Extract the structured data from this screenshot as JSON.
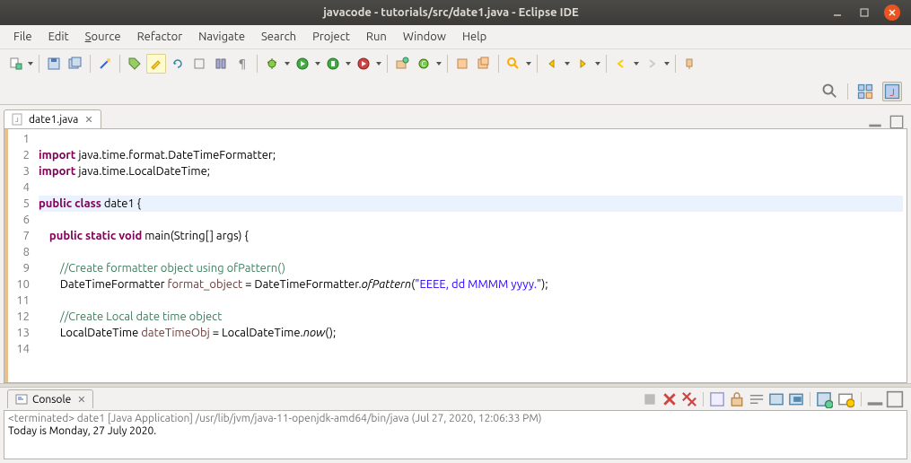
{
  "window": {
    "title": "javacode - tutorials/src/date1.java - Eclipse IDE"
  },
  "menu": {
    "items": [
      "File",
      "Edit",
      "Source",
      "Refactor",
      "Navigate",
      "Search",
      "Project",
      "Run",
      "Window",
      "Help"
    ]
  },
  "editor": {
    "tab_label": "date1.java",
    "lines": [
      {
        "n": "1",
        "text": ""
      },
      {
        "n": "2",
        "html": "<span class='kw'>import</span> java.time.format.DateTimeFormatter;"
      },
      {
        "n": "3",
        "html": "<span class='kw'>import</span> java.time.LocalDateTime;"
      },
      {
        "n": "4",
        "text": ""
      },
      {
        "n": "5",
        "html": "<span class='kw'>public</span> <span class='kw'>class</span> date1 {",
        "highlight": true
      },
      {
        "n": "6",
        "text": ""
      },
      {
        "n": "7",
        "html": "    <span class='kw'>public</span> <span class='kw'>static</span> <span class='kw'>void</span> main(String[] args) {"
      },
      {
        "n": "8",
        "text": ""
      },
      {
        "n": "9",
        "html": "        <span class='cm'>//Create formatter object using ofPattern()</span>"
      },
      {
        "n": "10",
        "html": "        DateTimeFormatter <span style='color:#6a3e3e'>format_object</span> = DateTimeFormatter.<span class='st'>ofPattern</span>(<span class='str'>\"EEEE, dd MMMM yyyy.\"</span>);"
      },
      {
        "n": "11",
        "text": ""
      },
      {
        "n": "12",
        "html": "        <span class='cm'>//Create Local date time object</span>"
      },
      {
        "n": "13",
        "html": "        LocalDateTime <span style='color:#6a3e3e'>dateTimeObj</span> = LocalDateTime.<span class='st'>now</span>();"
      },
      {
        "n": "14",
        "text": ""
      }
    ]
  },
  "console": {
    "tab_label": "Console",
    "status": "<terminated> date1 [Java Application] /usr/lib/jvm/java-11-openjdk-amd64/bin/java (Jul 27, 2020, 12:06:33 PM)",
    "output": "Today is Monday, 27 July 2020."
  }
}
